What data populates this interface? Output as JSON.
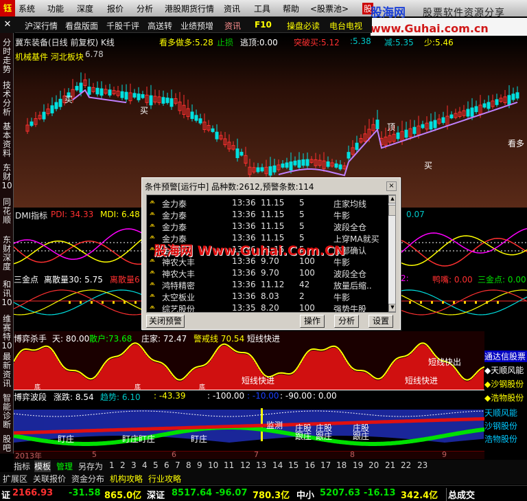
{
  "logo": "钰",
  "menu": [
    "系统",
    "功能",
    "深度",
    "报价",
    "分析",
    "港股期货行情",
    "资讯",
    "工具",
    "帮助",
    "<股票池>",
    "股"
  ],
  "brand": {
    "name": "股海网",
    "tagline": "股票软件资源分享",
    "url": "www.Guhai.com.cn"
  },
  "toolbar": [
    "沪深行情",
    "看盘版面",
    "千股千评",
    "高送转",
    "业绩预增",
    "资讯",
    "F10",
    "操盘必读",
    "电台电视"
  ],
  "leftnav": [
    "分时走势",
    "技术分析",
    "基本资料",
    "东财10",
    "同花顺",
    "东财深度",
    "和讯10",
    "维赛特10",
    "最新资讯",
    "智能诊断",
    "股吧"
  ],
  "kchart": {
    "stock": "冀东装备(日线 前复权)",
    "type": "K线",
    "tag": "机械基件 河北板块",
    "price_high": "6.78",
    "indicators": [
      {
        "label": "看多做多:",
        "value": "5.28",
        "color": "#ffff00"
      },
      {
        "label": "止损",
        "value": "",
        "color": "#00c800"
      },
      {
        "label": "逃顶:",
        "value": "0.00",
        "color": "#ffffff"
      },
      {
        "label": "突破买:",
        "value": "5.12",
        "color": "#ff3030"
      },
      {
        "label": ":",
        "value": "5.38",
        "color": "#00c8c8"
      },
      {
        "label": "减:",
        "value": "5.35",
        "color": "#00c8c8"
      },
      {
        "label": "少:",
        "value": "5.46",
        "color": "#ffff00"
      }
    ],
    "annotations": [
      "买",
      "买",
      "买",
      "顶",
      "看多"
    ]
  },
  "dmi": {
    "title": "DMI指标",
    "pdi_label": "PDI:",
    "pdi": "34.33",
    "mdi_label": "MDI:",
    "mdi": "6.48",
    "right_val": "0.07"
  },
  "kdj": {
    "items": [
      {
        "label": "三金点",
        "value": "",
        "color": "#ffffff"
      },
      {
        "label": "离散量30:",
        "value": "5.75",
        "color": "#ffffff"
      },
      {
        "label": "离散量6",
        "value": "",
        "color": "#ff3030"
      },
      {
        "label": "鸭嘴:",
        "value": "0.00",
        "color": "#ff3030"
      },
      {
        "label": "三金点:",
        "value": "0.00",
        "color": "#ffffff"
      }
    ],
    "left_num": "2:"
  },
  "bb": {
    "items": [
      {
        "label": "博弈杀手",
        "value": ""
      },
      {
        "label": "天:",
        "value": "80.00"
      },
      {
        "label": "散户:",
        "value": "73.68"
      },
      {
        "label": "庄家:",
        "value": "72.47"
      },
      {
        "label": "警戒线",
        "value": "70.54"
      },
      {
        "label": "短线快进",
        "value": ""
      }
    ],
    "signals": [
      "短线快进",
      "短线快进",
      "短线快出"
    ],
    "low_marks": [
      "底",
      "底",
      "底"
    ]
  },
  "wave": {
    "items": [
      {
        "label": "博弈波段",
        "color": "#ffffff"
      },
      {
        "label": "涨跌:",
        "value": "8.54",
        "color": "#ffffff"
      },
      {
        "label": "趋势:",
        "value": "6.10",
        "color": "#00c8c8"
      },
      {
        "label": ":",
        "value": "-43.39",
        "color": "#ffff00"
      },
      {
        "label": ":",
        "value": "-100.00",
        "color": "#ffffff"
      },
      {
        "label": ":",
        "value": "-10.00",
        "color": "#1a40ff"
      },
      {
        "label": ":",
        "value": "-90.00",
        "color": "#ffffff"
      },
      {
        "label": ":",
        "value": "0.00",
        "color": "#ffffff"
      }
    ],
    "marks": [
      "盯庄",
      "盯庄",
      "盯庄",
      "盯庄",
      "监测",
      "庄股",
      "庄股",
      "庄股",
      "跟庄",
      "跟庄",
      "跟庄"
    ]
  },
  "rightlist": {
    "header": "通达信股票",
    "items": [
      "天顺风能",
      "沙钢股份",
      "浩物股份",
      "天顺风能",
      "沙钢股份",
      "浩物股份"
    ]
  },
  "datebar": [
    "2013年",
    "5",
    "6",
    "7",
    "8",
    "9"
  ],
  "tabs1": [
    "指标",
    "模板",
    "管理",
    "另存为",
    "1",
    "2",
    "3",
    "4",
    "5",
    "6",
    "7",
    "8",
    "9",
    "10",
    "11",
    "12",
    "13",
    "14",
    "15",
    "16",
    "17",
    "18",
    "19",
    "20",
    "21",
    "22",
    "23"
  ],
  "tabs2": [
    "扩展区",
    "关联报价",
    "资金分布",
    "机构攻略",
    "行业攻略"
  ],
  "status": [
    {
      "label": "证",
      "value": "2166.93",
      "color": "#ff3030"
    },
    {
      "value": "-31.58",
      "color": "#00e000"
    },
    {
      "value": "865.0亿",
      "color": "#ffff00"
    },
    {
      "label": "深证",
      "value": "8517.64",
      "color": "#00e000"
    },
    {
      "value": "-96.07",
      "color": "#00e000"
    },
    {
      "value": "780.3亿",
      "color": "#ffff00"
    },
    {
      "label": "中小",
      "value": "5207.63",
      "color": "#00e000"
    },
    {
      "value": "-16.13",
      "color": "#00e000"
    },
    {
      "value": "342.4亿",
      "color": "#ffff00"
    },
    {
      "label": "总成交",
      "value": "",
      "color": "#ffffff"
    }
  ],
  "dialog": {
    "title": "条件预警[运行中] 品种数:2612,预警条数:114",
    "close": "×",
    "rows": [
      {
        "name": "金力泰",
        "time": "13:36",
        "price": "11.15",
        "n": "5",
        "signal": "庄家均线"
      },
      {
        "name": "金力泰",
        "time": "13:36",
        "price": "11.15",
        "n": "5",
        "signal": "牛影"
      },
      {
        "name": "金力泰",
        "time": "13:36",
        "price": "11.15",
        "n": "5",
        "signal": "波段全仓"
      },
      {
        "name": "金力泰",
        "time": "13:36",
        "price": "11.15",
        "n": "5",
        "signal": "上穿MA就买"
      },
      {
        "name": "金力泰",
        "time": "13:36",
        "price": "11.15",
        "n": "5",
        "signal": "底部确认"
      },
      {
        "name": "神农大丰",
        "time": "13:36",
        "price": "9.70",
        "n": "100",
        "signal": "牛影"
      },
      {
        "name": "神农大丰",
        "time": "13:36",
        "price": "9.70",
        "n": "100",
        "signal": "波段全仓"
      },
      {
        "name": "鸿特精密",
        "time": "13:36",
        "price": "11.12",
        "n": "42",
        "signal": "放量后缩.."
      },
      {
        "name": "太空板业",
        "time": "13:36",
        "price": "8.03",
        "n": "2",
        "signal": "牛影"
      },
      {
        "name": "综艺股份",
        "time": "13:35",
        "price": "8.20",
        "n": "100",
        "signal": "强势牛股"
      }
    ],
    "buttons": [
      "关闭预警",
      "操作",
      "分析",
      "设置"
    ]
  },
  "watermark": "股海网 Www.Guhai.Com.CN"
}
